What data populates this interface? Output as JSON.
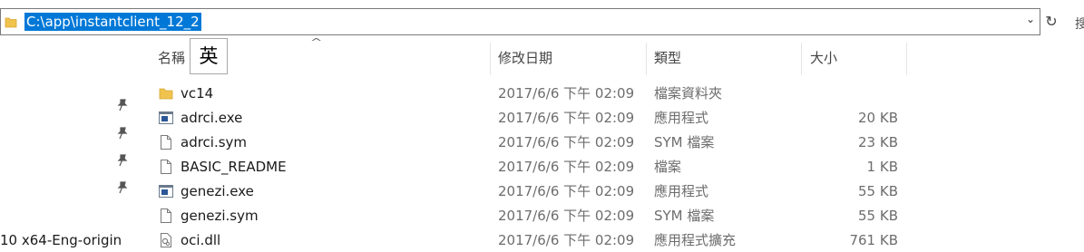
{
  "address_bar": {
    "path": "C:\\app\\instantclient_12_2"
  },
  "columns": {
    "name": "名稱",
    "date": "修改日期",
    "type": "類型",
    "size": "大小"
  },
  "ime_indicator": "英",
  "side_panel": {
    "partial_item": "10 x64-Eng-origin"
  },
  "files": [
    {
      "name": "vc14",
      "date": "2017/6/6 下午 02:09",
      "type": "檔案資料夾",
      "size": "",
      "icon": "folder-icon"
    },
    {
      "name": "adrci.exe",
      "date": "2017/6/6 下午 02:09",
      "type": "應用程式",
      "size": "20 KB",
      "icon": "exe-icon"
    },
    {
      "name": "adrci.sym",
      "date": "2017/6/6 下午 02:09",
      "type": "SYM 檔案",
      "size": "23 KB",
      "icon": "file-icon"
    },
    {
      "name": "BASIC_README",
      "date": "2017/6/6 下午 02:09",
      "type": "檔案",
      "size": "1 KB",
      "icon": "file-icon"
    },
    {
      "name": "genezi.exe",
      "date": "2017/6/6 下午 02:09",
      "type": "應用程式",
      "size": "55 KB",
      "icon": "exe-icon"
    },
    {
      "name": "genezi.sym",
      "date": "2017/6/6 下午 02:09",
      "type": "SYM 檔案",
      "size": "55 KB",
      "icon": "file-icon"
    },
    {
      "name": "oci.dll",
      "date": "2017/6/6 下午 02:09",
      "type": "應用程式擴充",
      "size": "761 KB",
      "icon": "dll-icon"
    }
  ],
  "colors": {
    "selection": "#0078d7",
    "folder": "#f0c24e",
    "exe": "#2b5797"
  }
}
